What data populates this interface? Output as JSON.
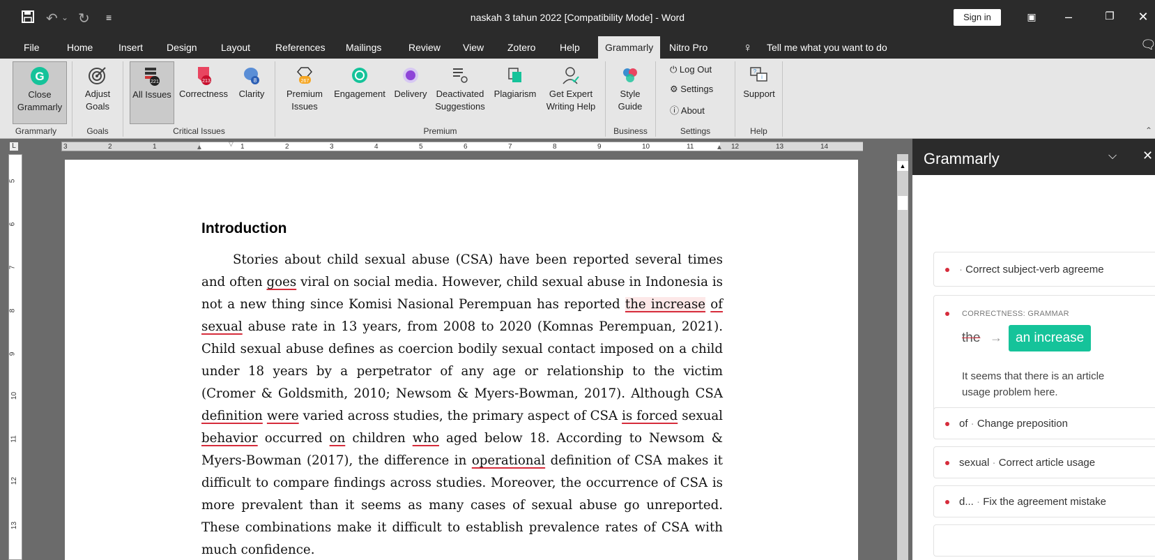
{
  "title_bar": {
    "title": "naskah 3 tahun 2022 [Compatibility Mode]  -  Word",
    "sign_in": "Sign in"
  },
  "menu_tabs": [
    "File",
    "Home",
    "Insert",
    "Design",
    "Layout",
    "References",
    "Mailings",
    "Review",
    "View",
    "Zotero",
    "Help",
    "Grammarly",
    "Nitro Pro"
  ],
  "active_tab": "Grammarly",
  "tell_me": "Tell me what you want to do",
  "ribbon": {
    "close_grammarly": [
      "Close",
      "Grammarly"
    ],
    "adjust_goals": [
      "Adjust",
      "Goals"
    ],
    "all_issues": "All Issues",
    "all_issues_badge": "221",
    "correctness": "Correctness",
    "correctness_badge": "213",
    "clarity": "Clarity",
    "clarity_badge": "8",
    "premium_issues": [
      "Premium",
      "Issues"
    ],
    "premium_badge": "267",
    "engagement": "Engagement",
    "delivery": "Delivery",
    "deactivated": [
      "Deactivated",
      "Suggestions"
    ],
    "plagiarism": "Plagiarism",
    "expert": [
      "Get Expert",
      "Writing Help"
    ],
    "style_guide": [
      "Style",
      "Guide"
    ],
    "log_out": "Log Out",
    "settings": "Settings",
    "about": "About",
    "support": "Support",
    "groups": {
      "grammarly": "Grammarly",
      "goals": "Goals",
      "critical": "Critical Issues",
      "premium": "Premium",
      "business": "Business",
      "settings": "Settings",
      "help": "Help"
    }
  },
  "ruler_numbers": [
    "3",
    "2",
    "1",
    "1",
    "2",
    "3",
    "4",
    "5",
    "6",
    "7",
    "8",
    "9",
    "10",
    "11",
    "12",
    "13",
    "14"
  ],
  "vruler_numbers": [
    "5",
    "6",
    "7",
    "8",
    "9",
    "10",
    "11",
    "12",
    "13"
  ],
  "document": {
    "heading": "Introduction",
    "lines": [
      [
        "Stories about child sexual abuse (CSA) have been reported several times"
      ],
      [
        "and often ",
        {
          "u": "goes"
        },
        " viral on social media. However, child sexual abuse in Indonesia is"
      ],
      [
        "not a new thing since Komisi Nasional Perempuan has reported ",
        {
          "u": "the increase",
          "hl": true
        },
        " ",
        {
          "u": "of"
        }
      ],
      [
        {
          "u": "sexual"
        },
        " abuse rate in 13 years, from 2008 to 2020 (Komnas Perempuan, 2021)."
      ],
      [
        "Child sexual abuse defines as coercion bodily sexual contact imposed on a child"
      ],
      [
        "under 18 years by a perpetrator of any age or relationship to the victim"
      ],
      [
        "(Cromer & Goldsmith, 2010; Newsom & Myers-Bowman, 2017). Although CSA"
      ],
      [
        {
          "u": "definition"
        },
        " ",
        {
          "u": "were"
        },
        " varied across studies, the primary aspect of CSA ",
        {
          "u": "is forced"
        },
        " sexual"
      ],
      [
        {
          "u": "behavior"
        },
        " occurred ",
        {
          "u": "on"
        },
        " children ",
        {
          "u": "who"
        },
        " aged below 18. According to Newsom &"
      ],
      [
        "Myers-Bowman (2017), the difference in ",
        {
          "u": "operational"
        },
        " definition of CSA makes it"
      ],
      [
        "difficult to compare findings across studies. Moreover, the occurrence of CSA is"
      ],
      [
        "more prevalent than it seems as many cases of sexual abuse go unreported."
      ],
      [
        "These combinations make it difficult to establish prevalence rates of CSA with"
      ],
      [
        "much confidence."
      ]
    ]
  },
  "grammarly_panel": {
    "title": "Grammarly",
    "suggestions": [
      {
        "word": "",
        "text": "Correct subject-verb agreeme"
      },
      {
        "word": "of",
        "text": "Change preposition"
      },
      {
        "word": "sexual",
        "text": "Correct article usage"
      },
      {
        "word": "d...",
        "text": "Fix the agreement mistake"
      }
    ],
    "active_card": {
      "category": "CORRECTNESS: GRAMMAR",
      "old": "the",
      "arrow": "→",
      "new": "an increase",
      "explanation": "It seems that there is an article usage problem here."
    }
  },
  "colors": {
    "accent_red": "#d62c3b",
    "grammarly_green": "#15c39a",
    "dark_bar": "#2b2b2b",
    "ribbon": "#e6e6e6"
  }
}
